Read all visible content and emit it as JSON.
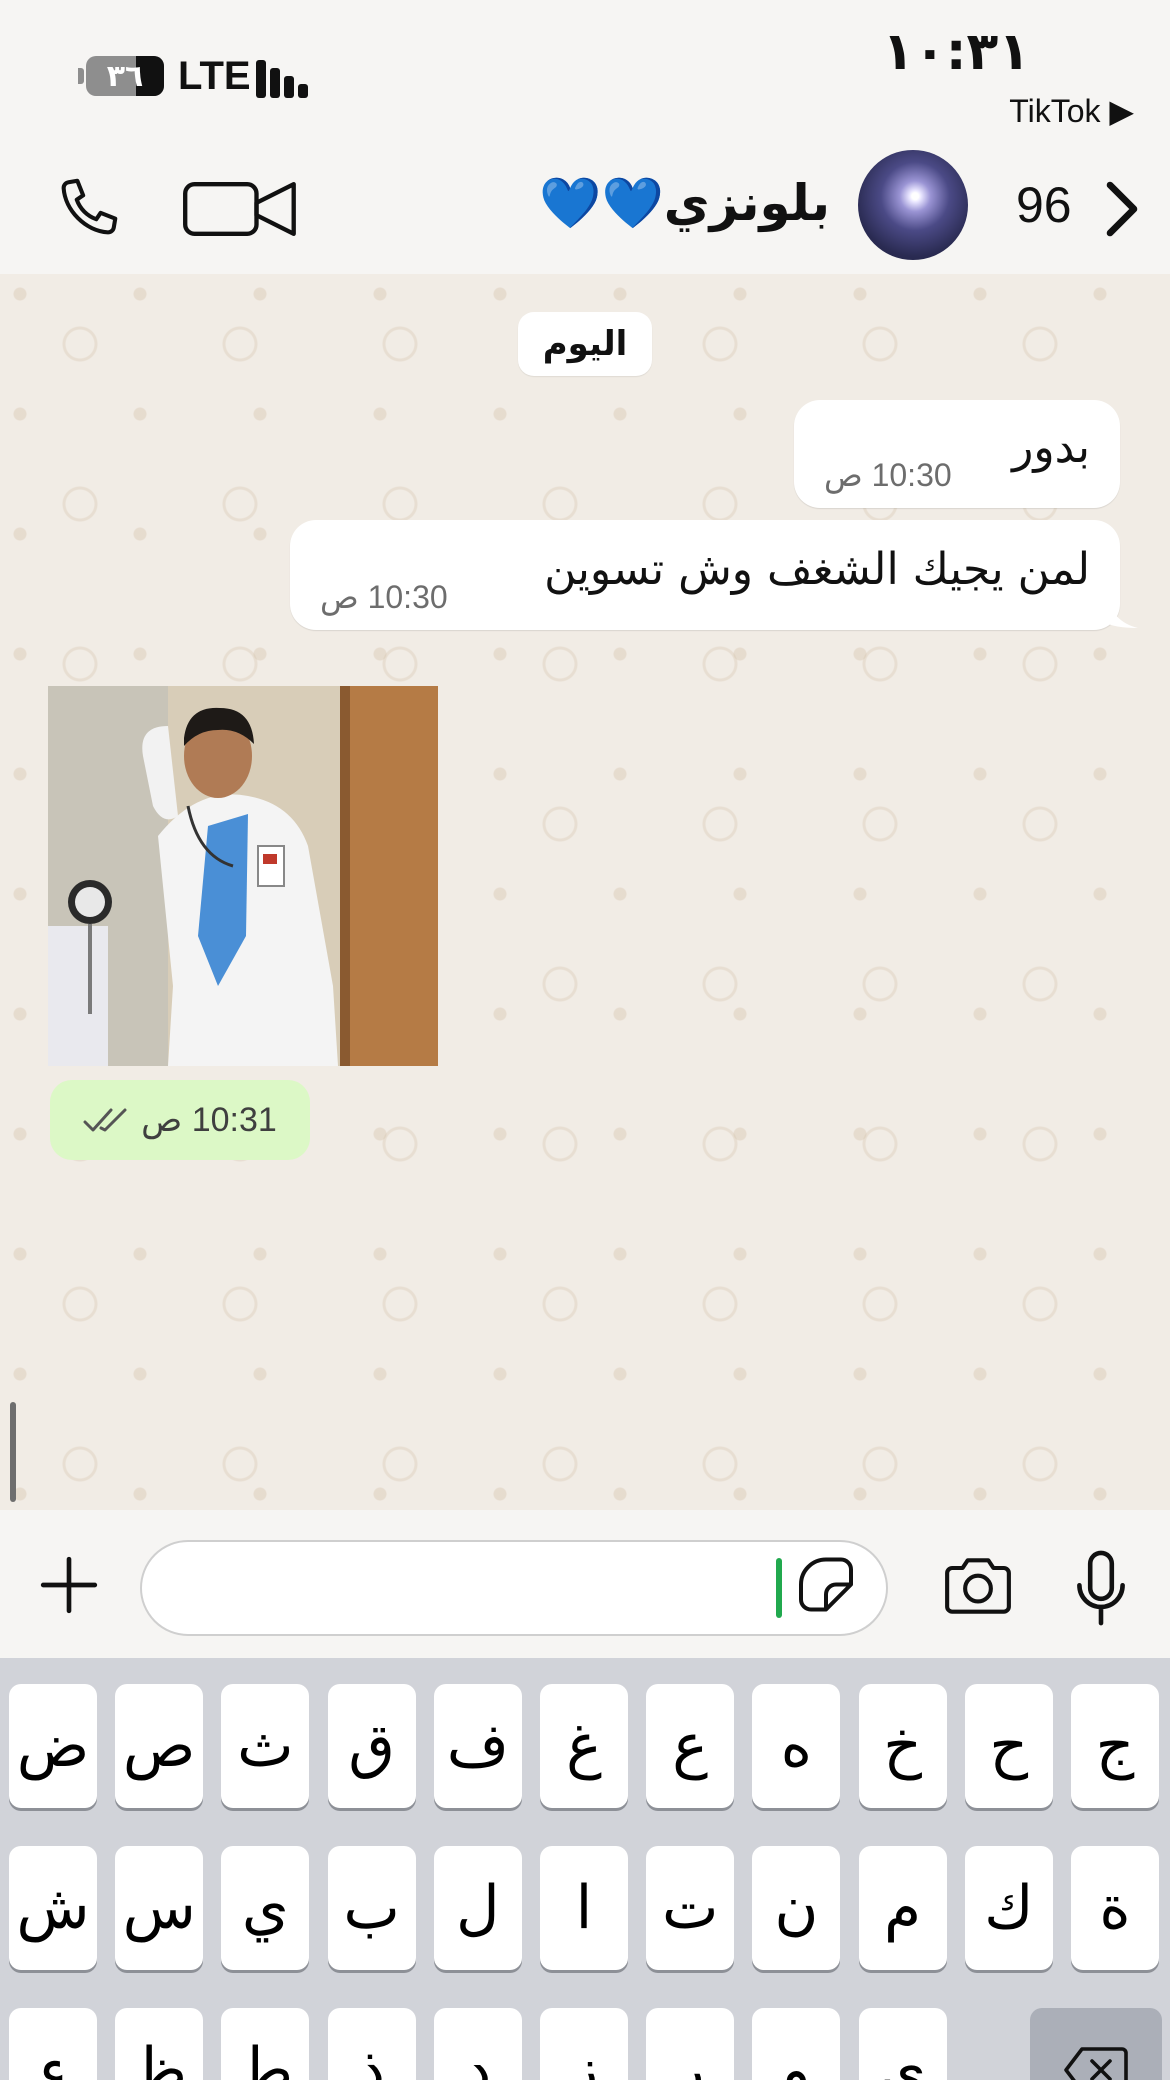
{
  "status_bar": {
    "battery_text": "٣٦",
    "battery_level": 0.36,
    "network": "LTE",
    "time": "١٠:٣١",
    "back_app": "TikTok ▶"
  },
  "header": {
    "unread_count": "96",
    "contact_name": "بلونزي💙💙",
    "icons": [
      "back-chevron-icon",
      "phone-icon",
      "video-camera-icon"
    ]
  },
  "chat": {
    "date_label": "اليوم",
    "messages": [
      {
        "text": "بدور",
        "time": "10:30 ص",
        "direction": "incoming"
      },
      {
        "text": "لمن يجيك الشغف وش تسوين",
        "time": "10:30 ص",
        "direction": "incoming"
      }
    ],
    "image_message": {
      "time": "10:31 ص",
      "status_icon": "double-check-icon",
      "direction": "outgoing"
    }
  },
  "input_bar": {
    "placeholder": "",
    "icons": [
      "plus-icon",
      "sticker-icon",
      "camera-icon",
      "microphone-icon"
    ]
  },
  "keyboard": {
    "row1": [
      "ض",
      "ص",
      "ث",
      "ق",
      "ف",
      "غ",
      "ع",
      "ه",
      "خ",
      "ح",
      "ج"
    ],
    "row2": [
      "ش",
      "س",
      "ي",
      "ب",
      "ل",
      "ا",
      "ت",
      "ن",
      "م",
      "ك",
      "ة"
    ],
    "row3": [
      "ء",
      "ظ",
      "ط",
      "ذ",
      "د",
      "ز",
      "ر",
      "و",
      "ى"
    ],
    "backspace_icon": "backspace-icon"
  }
}
